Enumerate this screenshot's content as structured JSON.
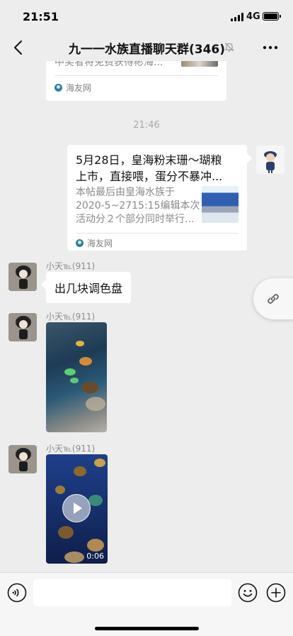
{
  "status_bar": {
    "time": "21:51",
    "network": "4G"
  },
  "nav": {
    "title": "九一一水族直播聊天群(346)"
  },
  "messages": {
    "top_card": {
      "text": "中奖者将免费获得彬海...",
      "source": "海友网"
    },
    "timestamp": "21:46",
    "link_card": {
      "title_line1": "5月28日，皇海粉末珊～瑚粮",
      "title_line2": "上市，直接喂，蛋分不暴冲...",
      "desc_line1": "本帖最后由皇海水族于",
      "desc_line2": "2020-5~2715:15编辑本次",
      "desc_line3": "活动分２个部分同时举行...",
      "source": "海友网"
    },
    "msg1": {
      "sender": "小天℡(911)",
      "text": "出几块调色盘"
    },
    "msg2": {
      "sender": "小天℡(911)"
    },
    "msg3": {
      "sender": "小天℡(911)",
      "duration": "0:06"
    }
  },
  "input": {
    "placeholder": ""
  }
}
